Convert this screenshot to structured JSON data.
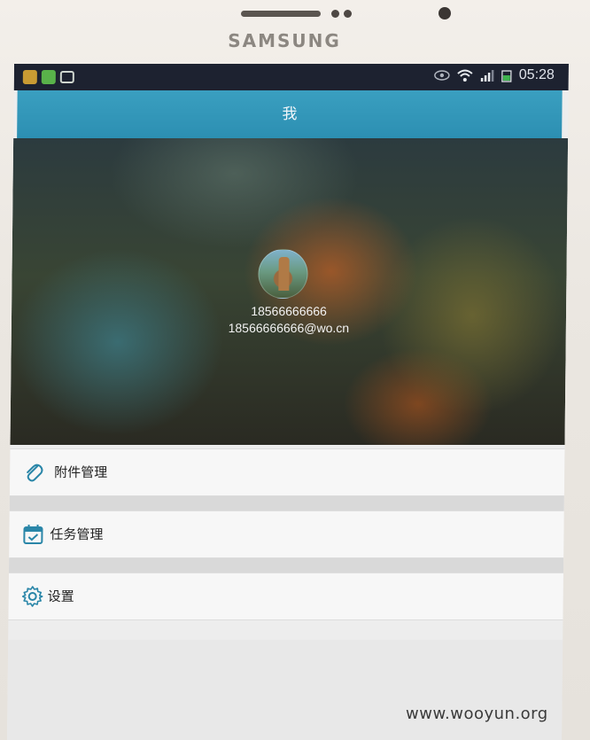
{
  "device": {
    "brand": "SAMSUNG"
  },
  "status_bar": {
    "time": "05:28"
  },
  "header": {
    "title": "我"
  },
  "profile": {
    "phone": "18566666666",
    "email": "18566666666@wo.cn"
  },
  "menu": {
    "items": [
      {
        "label": "附件管理",
        "icon": "paperclip-icon"
      },
      {
        "label": "任务管理",
        "icon": "calendar-icon"
      },
      {
        "label": "设置",
        "icon": "gear-icon"
      }
    ]
  },
  "watermark": "www.wooyun.org",
  "colors": {
    "titlebar": "#2c8fb2",
    "status_bar": "#1d2230",
    "icon_accent": "#2a86a8"
  }
}
